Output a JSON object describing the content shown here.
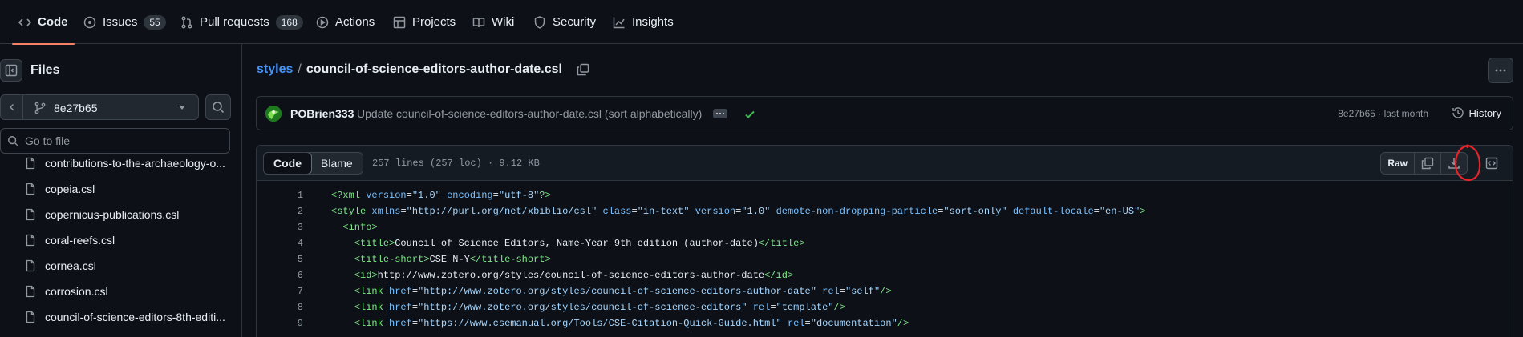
{
  "nav": {
    "tabs": [
      {
        "label": "Code",
        "icon": "code-icon",
        "active": true
      },
      {
        "label": "Issues",
        "icon": "issue-icon",
        "count": "55"
      },
      {
        "label": "Pull requests",
        "icon": "pull-request-icon",
        "count": "168"
      },
      {
        "label": "Actions",
        "icon": "play-icon"
      },
      {
        "label": "Projects",
        "icon": "table-icon"
      },
      {
        "label": "Wiki",
        "icon": "book-icon"
      },
      {
        "label": "Security",
        "icon": "shield-icon"
      },
      {
        "label": "Insights",
        "icon": "graph-icon"
      }
    ]
  },
  "sidebar": {
    "title": "Files",
    "branch": "8e27b65",
    "goto_placeholder": "Go to file",
    "items": [
      "contributions-to-the-archaeology-o...",
      "copeia.csl",
      "copernicus-publications.csl",
      "coral-reefs.csl",
      "cornea.csl",
      "corrosion.csl",
      "council-of-science-editors-8th-editi..."
    ]
  },
  "breadcrumb": {
    "repo_dir": "styles",
    "separator": "/",
    "filename": "council-of-science-editors-author-date.csl"
  },
  "commit": {
    "author": "POBrien333",
    "message": "Update council-of-science-editors-author-date.csl (sort alphabetically)",
    "meta": "8e27b65 · last month",
    "history_label": "History"
  },
  "file": {
    "tab_code": "Code",
    "tab_blame": "Blame",
    "info": "257 lines (257 loc) · 9.12 KB",
    "raw_label": "Raw"
  },
  "code_lines": [
    {
      "n": "1",
      "text": "<?xml version=\"1.0\" encoding=\"utf-8\"?>"
    },
    {
      "n": "2",
      "text": "<style xmlns=\"http://purl.org/net/xbiblio/csl\" class=\"in-text\" version=\"1.0\" demote-non-dropping-particle=\"sort-only\" default-locale=\"en-US\">"
    },
    {
      "n": "3",
      "text": "  <info>"
    },
    {
      "n": "4",
      "text": "    <title>Council of Science Editors, Name-Year 9th edition (author-date)</title>"
    },
    {
      "n": "5",
      "text": "    <title-short>CSE N-Y</title-short>"
    },
    {
      "n": "6",
      "text": "    <id>http://www.zotero.org/styles/council-of-science-editors-author-date</id>"
    },
    {
      "n": "7",
      "text": "    <link href=\"http://www.zotero.org/styles/council-of-science-editors-author-date\" rel=\"self\"/>"
    },
    {
      "n": "8",
      "text": "    <link href=\"http://www.zotero.org/styles/council-of-science-editors\" rel=\"template\"/>"
    },
    {
      "n": "9",
      "text": "    <link href=\"https://www.csemanual.org/Tools/CSE-Citation-Quick-Guide.html\" rel=\"documentation\"/>"
    }
  ],
  "colors": {
    "accent_underline": "#f78166",
    "link": "#4493f8",
    "success": "#3fb950",
    "annotation": "#e5252a"
  }
}
